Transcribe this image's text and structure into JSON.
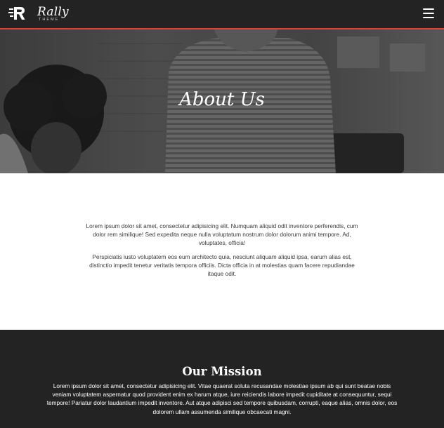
{
  "header": {
    "brand_name": "Rally",
    "brand_subtitle": "THEME",
    "logo_icon": "rally-r-logo-icon",
    "menu_icon": "hamburger-menu-icon",
    "accent_color": "#ea3b3b"
  },
  "hero": {
    "title": "About Us"
  },
  "about": {
    "paragraphs": [
      "Lorem ipsum dolor sit amet, consectetur adipisicing elit. Numquam aliquid odit inventore perferendis, cum dolor rem similique! Sed expedita neque nulla voluptatum nostrum dolor dolorum animi tempore. Ad, voluptates, officia!",
      "Perspiciatis iusto voluptatem eos eum architecto quia, nesciunt aliquam aliquid ipsa, earum alias est, distinctio impedit tenetur veritatis tempora officiis. Dicta officia in at molestias quam facere repudiandae itaque odit."
    ]
  },
  "mission": {
    "title": "Our Mission",
    "text": "Lorem ipsum dolor sit amet, consectetur adipisicing elit. Vitae quaerat soluta recusandae molestiae ipsum ab qui sunt beatae nobis veniam voluptatem aspernatur quod provident enim ex harum atque, iure reiciendis labore impedit cupiditate at consequuntur, sequi tempore! Pariatur dolor laudantium impedit inventore. Aut atque adipisci sed tempore quibusdam, corrupti, eaque alias, omnis dolor, eos dolorem ullam assumenda similique obcaecati magni."
  }
}
